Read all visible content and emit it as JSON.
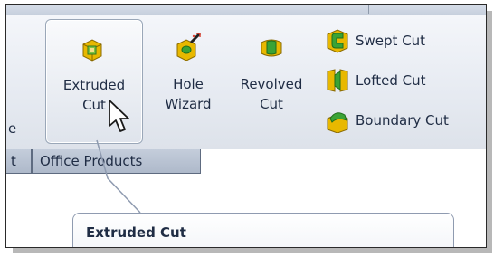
{
  "ribbon": {
    "partial_left_label": "e",
    "extruded_cut": {
      "line1": "Extruded",
      "line2": "Cut",
      "icon": "extruded-cut-icon",
      "state": "hover"
    },
    "hole_wizard": {
      "line1": "Hole",
      "line2": "Wizard",
      "icon": "hole-wizard-icon"
    },
    "revolved_cut": {
      "line1": "Revolved",
      "line2": "Cut",
      "icon": "revolved-cut-icon"
    },
    "swept_cut": {
      "label": "Swept Cut",
      "icon": "swept-cut-icon"
    },
    "lofted_cut": {
      "label": "Lofted Cut",
      "icon": "lofted-cut-icon"
    },
    "boundary_cut": {
      "label": "Boundary Cut",
      "icon": "boundary-cut-icon"
    }
  },
  "tabs": {
    "partial_tab_label": "t",
    "office_products": "Office Products"
  },
  "tooltip": {
    "title": "Extruded Cut"
  },
  "colors": {
    "ribbon_bg": "#e7ebf2",
    "tab_bg": "#b8c2d2",
    "icon_yellow": "#f2c400",
    "icon_green": "#3aa336",
    "text": "#1f2c44"
  }
}
